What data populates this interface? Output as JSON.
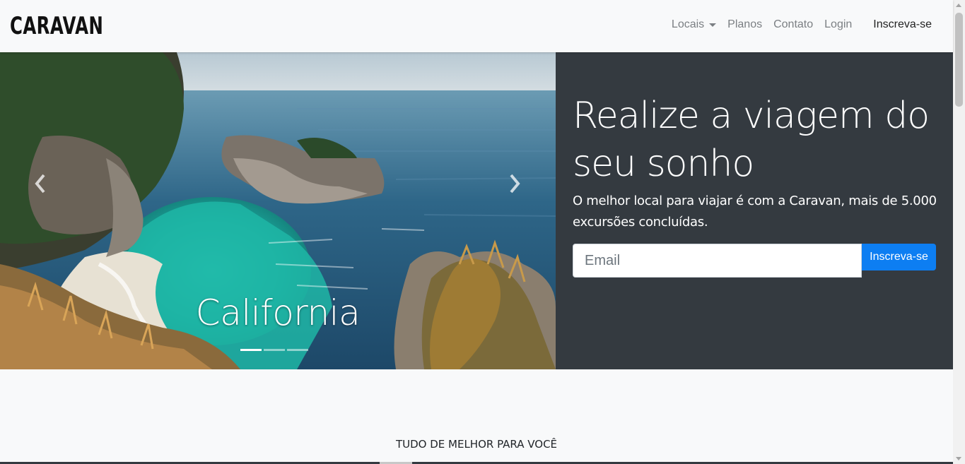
{
  "navbar": {
    "brand": "CARAVAN",
    "links": {
      "locais": "Locais",
      "planos": "Planos",
      "contato": "Contato",
      "login": "Login"
    },
    "cta": "Inscreva-se"
  },
  "carousel": {
    "caption": "California",
    "slide_count": 3,
    "active_slide": 1,
    "icons": {
      "prev": "chevron-left-icon",
      "next": "chevron-right-icon"
    }
  },
  "signup": {
    "title": "Realize a viagem do seu sonho",
    "text": "O melhor local para viajar é com a Caravan, mais de 5.000 excursões concluídas.",
    "email_placeholder": "Email",
    "email_value": "",
    "button_label": "Inscreva-se"
  },
  "section": {
    "heading": "TUDO DE MELHOR PARA VOCÊ"
  },
  "colors": {
    "navbar_bg": "#f8f9fa",
    "panel_bg": "#343a40",
    "primary": "#0d7ef2",
    "nav_text": "#7b7f83"
  }
}
